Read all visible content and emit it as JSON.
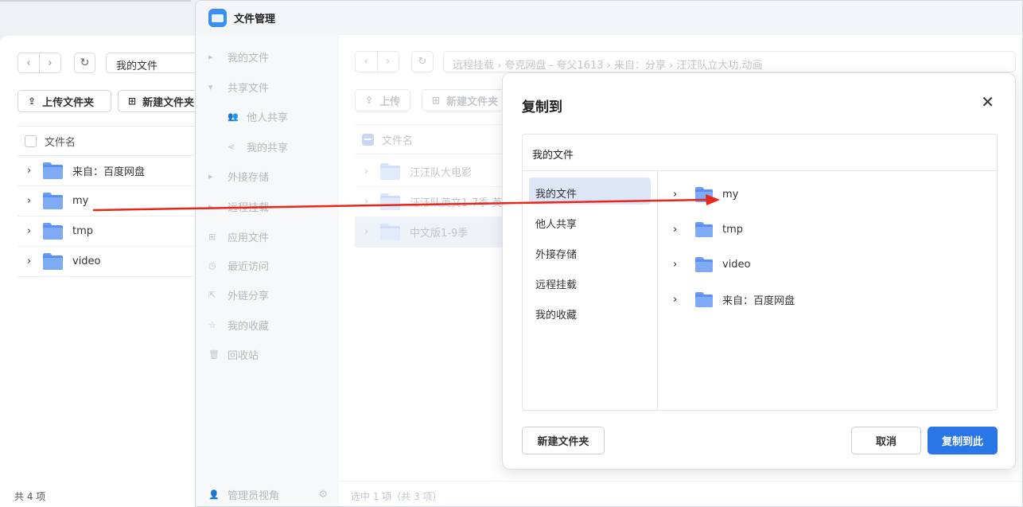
{
  "background_window": {
    "path": "我的文件",
    "upload_label": "上传文件夹",
    "new_folder_label": "新建文件夹",
    "col_filename": "文件名",
    "rows": [
      "来自：百度网盘",
      "my",
      "tmp",
      "video"
    ],
    "count": "共 4 项"
  },
  "file_manager": {
    "title": "文件管理",
    "sidebar": {
      "my_files": "我的文件",
      "shared_files": "共享文件",
      "shared_by_others": "他人共享",
      "my_shares": "我的共享",
      "external_storage": "外接存储",
      "remote_mount": "远程挂载",
      "app_files": "应用文件",
      "recent": "最近访问",
      "link_share": "外链分享",
      "favorites": "我的收藏",
      "recycle_bin": "回收站",
      "admin_view": "管理员视角"
    },
    "path": "远程挂载 › 夸克网盘 - 夸父1613 › 来自：分享 › 汪汪队立大功.动画",
    "upload_label": "上传",
    "new_folder_label": "新建文件夹",
    "col_filename": "文件名",
    "rows": [
      "汪汪队大电影",
      "汪汪队英文1-7季 英",
      "中文版1-9季"
    ],
    "status": "选中 1 项（共 3 项）"
  },
  "dialog": {
    "title": "复制到",
    "path": "我的文件",
    "locations": [
      "我的文件",
      "他人共享",
      "外接存储",
      "远程挂载",
      "我的收藏"
    ],
    "folders": [
      "my",
      "tmp",
      "video",
      "来自：百度网盘"
    ],
    "new_folder_button": "新建文件夹",
    "cancel_button": "取消",
    "confirm_button": "复制到此"
  },
  "colors": {
    "accent": "#2a76e6",
    "folder": "#5b8ff0",
    "arrow": "#e8261c",
    "selected_location": "#dce6f7"
  }
}
